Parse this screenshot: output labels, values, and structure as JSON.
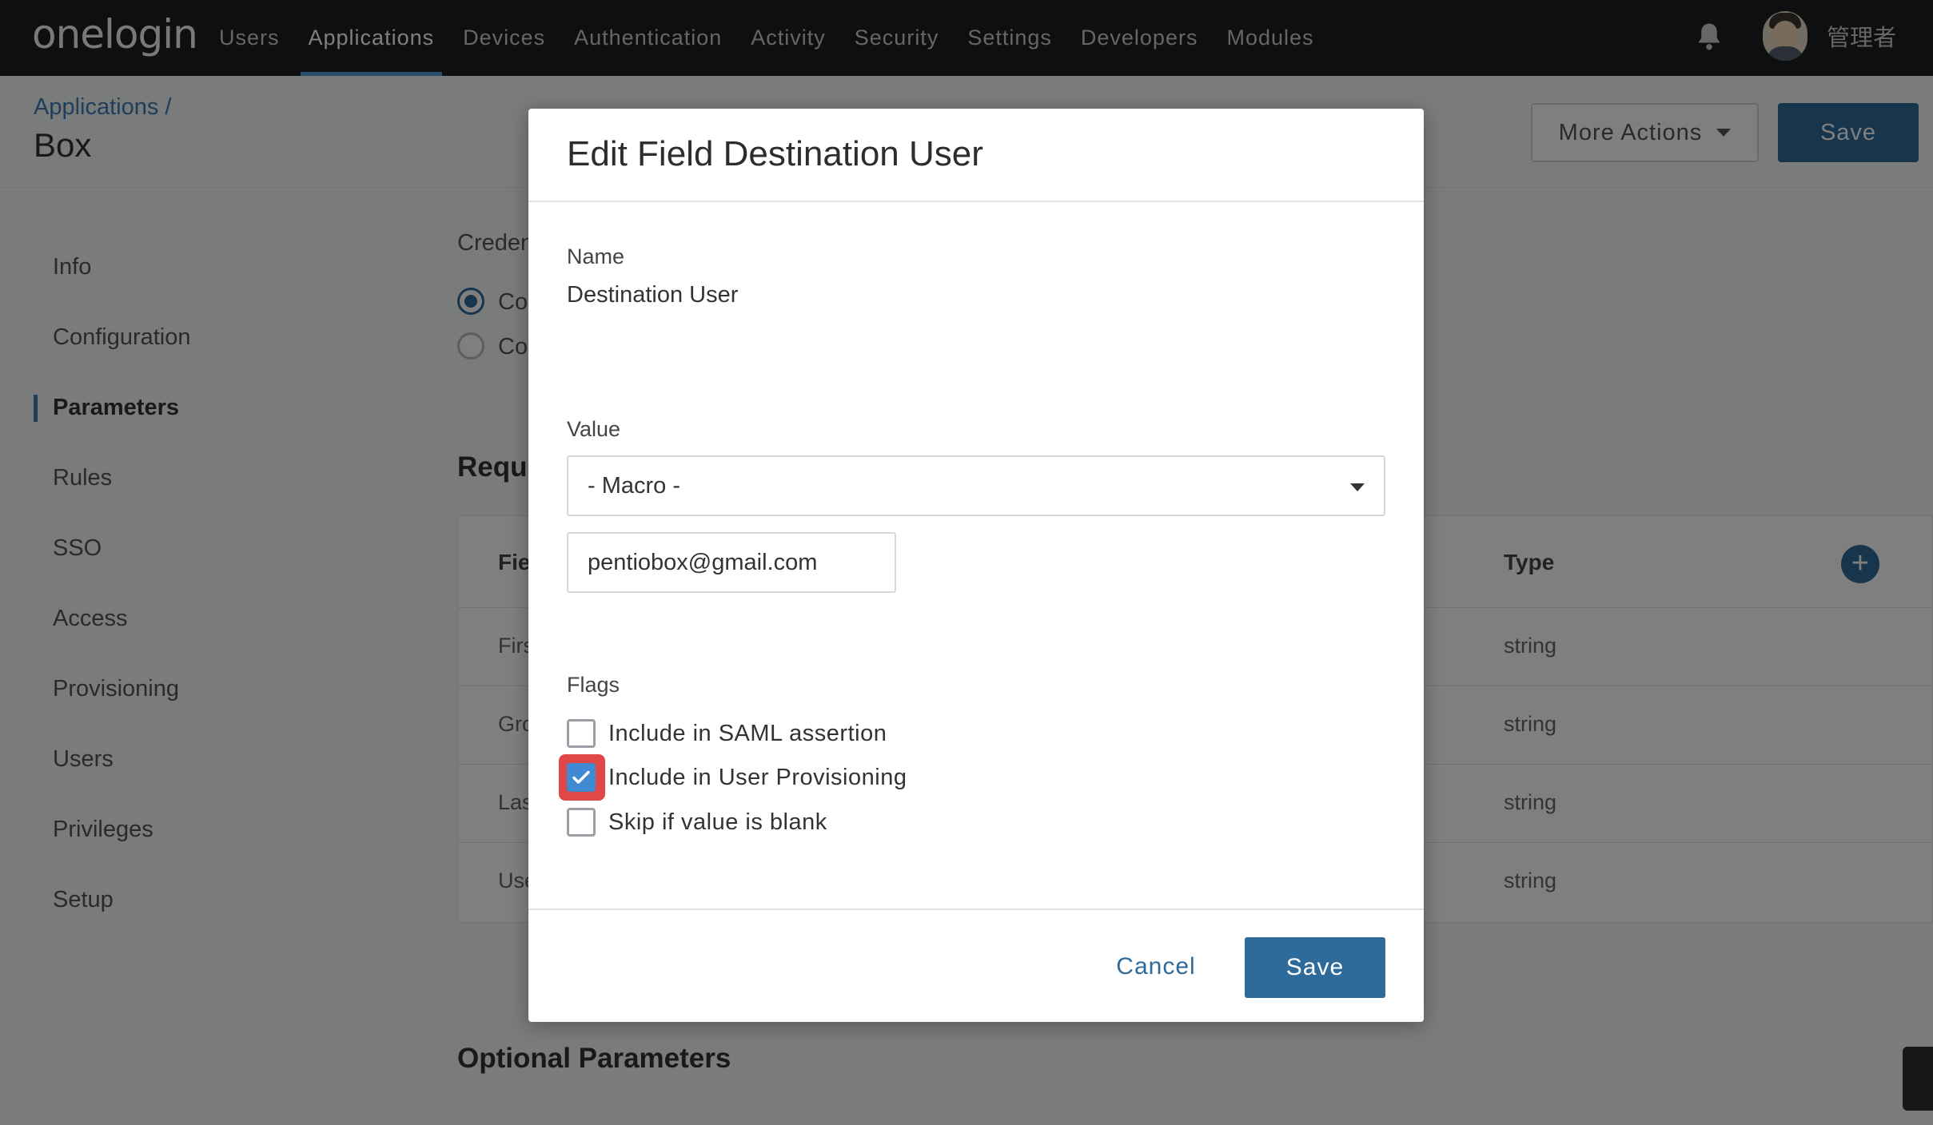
{
  "brand": {
    "logo": "onelogin",
    "accent": "#2f6b9a",
    "highlight": "#e04848"
  },
  "topnav": {
    "items": [
      "Users",
      "Applications",
      "Devices",
      "Authentication",
      "Activity",
      "Security",
      "Settings",
      "Developers",
      "Modules"
    ],
    "active": "Applications",
    "username": "管理者",
    "icons": [
      "bell-icon",
      "avatar"
    ]
  },
  "page": {
    "breadcrumb": "Applications /",
    "title": "Box",
    "more_actions_label": "More Actions",
    "save_label": "Save"
  },
  "sidenav": {
    "items": [
      "Info",
      "Configuration",
      "Parameters",
      "Rules",
      "SSO",
      "Access",
      "Provisioning",
      "Users",
      "Privileges",
      "Setup"
    ],
    "active": "Parameters"
  },
  "background": {
    "credentials_label": "Creden",
    "radio_1": "Co",
    "radio_2": "Co",
    "required_heading": "Requi",
    "table_col_field": "Fie",
    "table_col_type": "Type",
    "rows": [
      {
        "field": "Firs",
        "type": "string"
      },
      {
        "field": "Gro",
        "type": "string"
      },
      {
        "field": "Las",
        "type": "string"
      },
      {
        "field": "Use",
        "type": "string"
      }
    ],
    "optional_heading": "Optional Parameters"
  },
  "modal": {
    "title": "Edit Field Destination User",
    "name_label": "Name",
    "name_value": "Destination User",
    "value_label": "Value",
    "value_select": "- Macro -",
    "macro_value": "pentiobox@gmail.com",
    "flags_label": "Flags",
    "flags": [
      {
        "label": "Include in SAML assertion",
        "checked": false
      },
      {
        "label": "Include in User Provisioning",
        "checked": true
      },
      {
        "label": "Skip if value is blank",
        "checked": false
      }
    ],
    "cancel_label": "Cancel",
    "save_label": "Save"
  }
}
